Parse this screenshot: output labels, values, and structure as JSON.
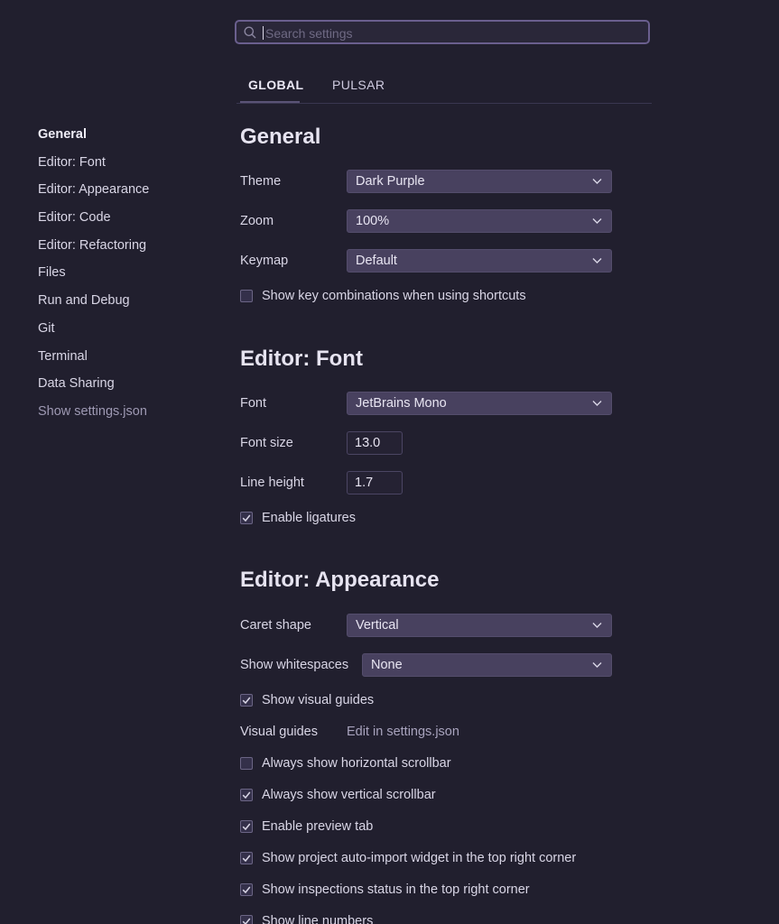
{
  "search": {
    "placeholder": "Search settings",
    "value": ""
  },
  "tabs": [
    {
      "label": "GLOBAL",
      "active": true
    },
    {
      "label": "PULSAR",
      "active": false
    }
  ],
  "sidebar": {
    "items": [
      {
        "label": "General",
        "active": true
      },
      {
        "label": "Editor: Font"
      },
      {
        "label": "Editor: Appearance"
      },
      {
        "label": "Editor: Code"
      },
      {
        "label": "Editor: Refactoring"
      },
      {
        "label": "Files"
      },
      {
        "label": "Run and Debug"
      },
      {
        "label": "Git"
      },
      {
        "label": "Terminal"
      },
      {
        "label": "Data Sharing"
      },
      {
        "label": "Show settings.json",
        "muted": true
      }
    ]
  },
  "general": {
    "title": "General",
    "theme": {
      "label": "Theme",
      "value": "Dark Purple"
    },
    "zoom": {
      "label": "Zoom",
      "value": "100%"
    },
    "keymap": {
      "label": "Keymap",
      "value": "Default"
    },
    "show_key_combinations": {
      "label": "Show key combinations when using shortcuts",
      "checked": false
    }
  },
  "editor_font": {
    "title": "Editor: Font",
    "font": {
      "label": "Font",
      "value": "JetBrains Mono"
    },
    "font_size": {
      "label": "Font size",
      "value": "13.0"
    },
    "line_height": {
      "label": "Line height",
      "value": "1.7"
    },
    "enable_ligatures": {
      "label": "Enable ligatures",
      "checked": true
    }
  },
  "editor_appearance": {
    "title": "Editor: Appearance",
    "caret_shape": {
      "label": "Caret shape",
      "value": "Vertical"
    },
    "show_whitespaces": {
      "label": "Show whitespaces",
      "value": "None"
    },
    "show_visual_guides": {
      "label": "Show visual guides",
      "checked": true
    },
    "visual_guides": {
      "label": "Visual guides",
      "link": "Edit in settings.json"
    },
    "always_show_horizontal_scrollbar": {
      "label": "Always show horizontal scrollbar",
      "checked": false
    },
    "always_show_vertical_scrollbar": {
      "label": "Always show vertical scrollbar",
      "checked": true
    },
    "enable_preview_tab": {
      "label": "Enable preview tab",
      "checked": true
    },
    "show_auto_import_widget": {
      "label": "Show project auto-import widget in the top right corner",
      "checked": true
    },
    "show_inspections_status": {
      "label": "Show inspections status in the top right corner",
      "checked": true
    },
    "show_line_numbers": {
      "label": "Show line numbers",
      "checked": true
    }
  }
}
